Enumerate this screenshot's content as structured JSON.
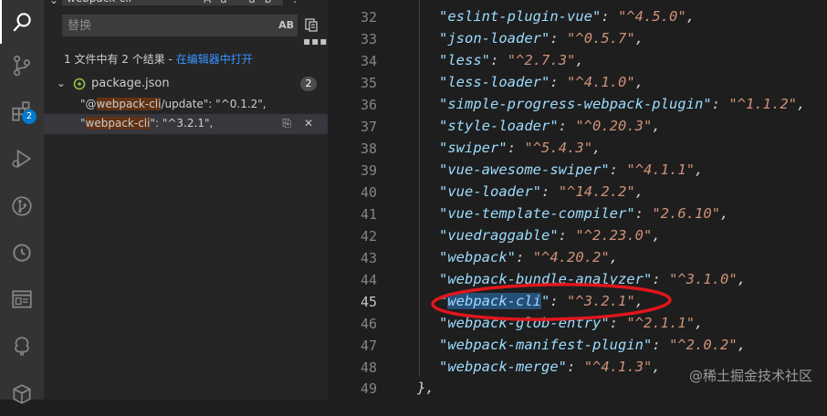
{
  "sidebar": {
    "search_value": "webpack-cli",
    "replace_placeholder": "替换",
    "preserve_case_label": "AB",
    "result_summary": "1 文件中有 2 个结果 - ",
    "open_in_editor_link": "在编辑器中打开",
    "file": {
      "name": "package.json",
      "count": "2"
    },
    "matches": [
      {
        "before": "\"@",
        "match": "webpack-cli",
        "after": "/update\": \"^0.1.2\","
      },
      {
        "before": "\"",
        "match": "webpack-cli",
        "after": "\": \"^3.2.1\","
      }
    ]
  },
  "activity_bar": {
    "extensions_badge": "2",
    "icons": [
      "search-icon",
      "source-control-icon",
      "extensions-icon",
      "run-debug-icon",
      "git-graph-icon",
      "timeline-icon",
      "browser-preview-icon",
      "tree-icon",
      "package-icon"
    ]
  },
  "editor": {
    "lines": [
      {
        "num": "32",
        "key": "eslint-plugin-vue",
        "value": "^4.5.0"
      },
      {
        "num": "33",
        "key": "json-loader",
        "value": "^0.5.7"
      },
      {
        "num": "34",
        "key": "less",
        "value": "^2.7.3"
      },
      {
        "num": "35",
        "key": "less-loader",
        "value": "^4.1.0"
      },
      {
        "num": "36",
        "key": "simple-progress-webpack-plugin",
        "value": "^1.1.2"
      },
      {
        "num": "37",
        "key": "style-loader",
        "value": "^0.20.3"
      },
      {
        "num": "38",
        "key": "swiper",
        "value": "^5.4.3"
      },
      {
        "num": "39",
        "key": "vue-awesome-swiper",
        "value": "^4.1.1"
      },
      {
        "num": "40",
        "key": "vue-loader",
        "value": "^14.2.2"
      },
      {
        "num": "41",
        "key": "vue-template-compiler",
        "value": "2.6.10"
      },
      {
        "num": "42",
        "key": "vuedraggable",
        "value": "^2.23.0"
      },
      {
        "num": "43",
        "key": "webpack",
        "value": "^4.20.2"
      },
      {
        "num": "44",
        "key": "webpack-bundle-analyzer",
        "value": "^3.1.0"
      },
      {
        "num": "45",
        "key": "webpack-cli",
        "value": "^3.2.1"
      },
      {
        "num": "46",
        "key": "webpack-glob-entry",
        "value": "^2.1.1"
      },
      {
        "num": "47",
        "key": "webpack-manifest-plugin",
        "value": "^2.0.2"
      },
      {
        "num": "48",
        "key": "webpack-merge",
        "value": "^4.1.3"
      }
    ],
    "last_line_num": "49",
    "closing_text": "},",
    "active_line": "45"
  },
  "watermark": "@稀土掘金技术社区",
  "colors": {
    "accent": "#007acc",
    "annotation_red": "#e0161c",
    "match_highlight": "#613214"
  }
}
